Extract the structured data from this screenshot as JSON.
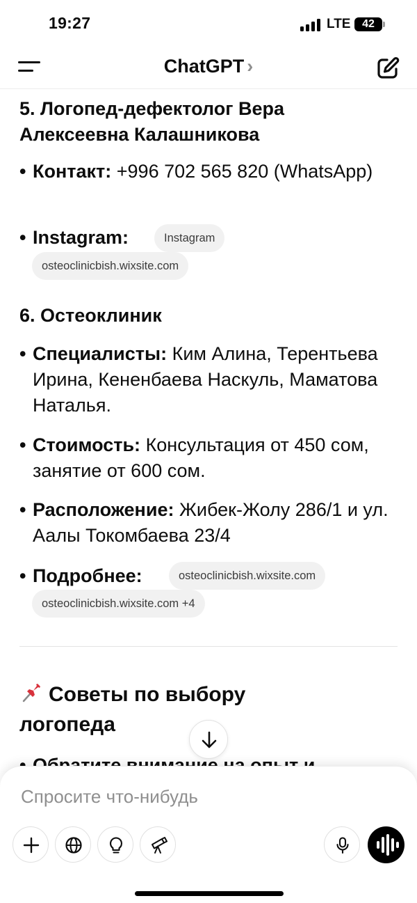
{
  "status_bar": {
    "time": "19:27",
    "network": "LTE",
    "battery": "42"
  },
  "header": {
    "title": "ChatGPT",
    "chevron": "›"
  },
  "sections": [
    {
      "heading": "5. Логопед-дефектолог Вера Алексеевна Калашникова",
      "contact_label": "Контакт:",
      "contact_text": "+996 702 565 820 (WhatsApp)",
      "instagram_label": "Instagram:",
      "chips": [
        "Instagram",
        "osteoclinicbish.wixsite.com"
      ]
    },
    {
      "heading": "6. Остеоклиник",
      "specialists_label": "Специалисты:",
      "specialists_text": "Ким Алина, Терентьева Ирина, Кененбаева Наскуль, Маматова Наталья.",
      "cost_label": "Стоимость:",
      "cost_text": "Консультация от 450 сом, занятие от 600 сом.",
      "location_label": "Расположение:",
      "location_text": "Жибек-Жолу 286/1 и ул. Аалы Токомбаева 23/4",
      "more_label": "Подробнее:",
      "chips": [
        "osteoclinicbish.wixsite.com",
        "osteoclinicbish.wixsite.com +4"
      ]
    }
  ],
  "tips": {
    "icon": "pushpin-icon",
    "heading": "Советы по выбору логопеда",
    "first_bullet_partial": "Обратите внимание на опыт и"
  },
  "composer": {
    "placeholder": "Спросите что-нибудь",
    "tools": [
      "plus-icon",
      "globe-icon",
      "lightbulb-icon",
      "telescope-icon"
    ],
    "mic": "microphone-icon",
    "voice": "voice-mode-icon"
  },
  "colors": {
    "text": "#0d0d0d",
    "chip_bg": "#f1f1f1",
    "placeholder": "#8f8f8f",
    "pin_red": "#d8323c"
  }
}
